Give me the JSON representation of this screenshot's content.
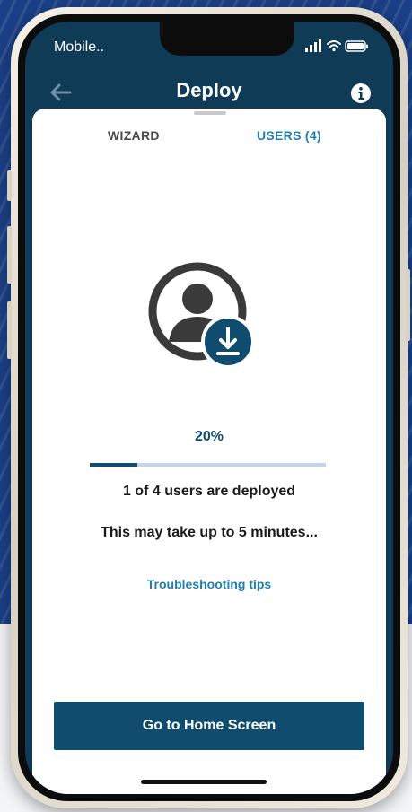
{
  "status_bar": {
    "carrier": "Mobile..",
    "icons": [
      "signal-icon",
      "wifi-icon",
      "battery-icon"
    ]
  },
  "header": {
    "title": "Deploy",
    "back_icon": "arrow-left-icon",
    "info_icon": "info-icon"
  },
  "tabs": [
    {
      "label": "WIZARD",
      "active": false
    },
    {
      "label": "USERS (4)",
      "active": true
    }
  ],
  "deploy": {
    "icon": "user-download-icon",
    "percent_label": "20%",
    "progress": 0.2,
    "status_text": "1 of 4 users are deployed",
    "wait_text": "This may take up to 5 minutes...",
    "tips_link": "Troubleshooting tips"
  },
  "actions": {
    "home_button": "Go to Home Screen"
  },
  "colors": {
    "primary": "#0f4c6e",
    "link": "#1f7fb0",
    "track": "#c4d5ea",
    "background": "#1b3f86"
  }
}
